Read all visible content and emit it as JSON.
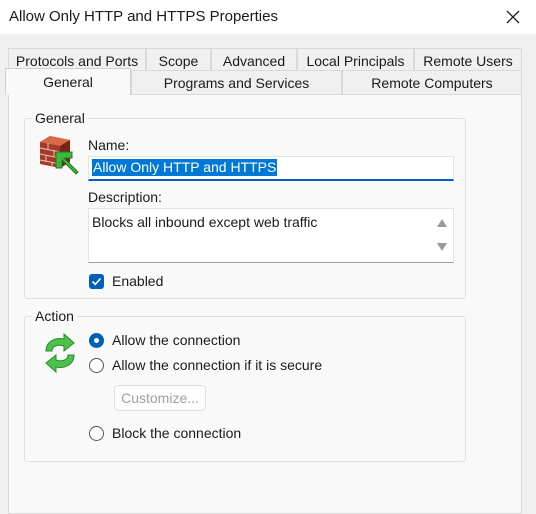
{
  "window": {
    "title": "Allow Only HTTP and HTTPS Properties"
  },
  "tabs_row1": [
    "Protocols and Ports",
    "Scope",
    "Advanced",
    "Local Principals",
    "Remote Users"
  ],
  "tabs_row2": [
    "General",
    "Programs and Services",
    "Remote Computers"
  ],
  "active_tab": "General",
  "general": {
    "group_label": "General",
    "name_label": "Name:",
    "name_value": "Allow Only HTTP and HTTPS",
    "description_label": "Description:",
    "description_value": "Blocks all inbound except web traffic",
    "enabled_label": "Enabled",
    "enabled": true
  },
  "action": {
    "group_label": "Action",
    "options": [
      "Allow the connection",
      "Allow the connection if it is secure",
      "Block the connection"
    ],
    "selected": "Allow the connection",
    "customize_label": "Customize..."
  },
  "colors": {
    "accent": "#005fb8",
    "selection": "#0078d7"
  },
  "icons": {
    "general_group": "firewall-rule-icon",
    "action_group": "sync-arrows-icon"
  }
}
